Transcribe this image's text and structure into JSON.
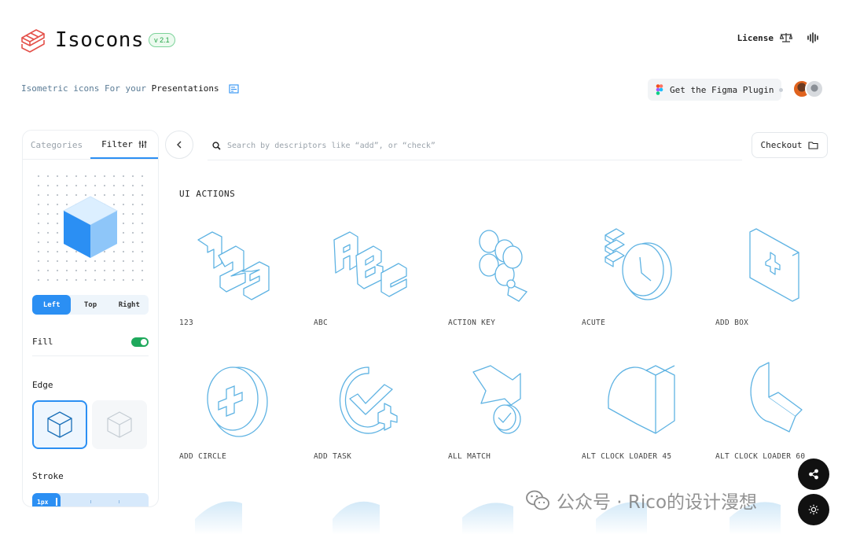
{
  "app": {
    "title": "Isocons",
    "version": "v 2.1",
    "tagline_prefix": "Isometric icons For your",
    "tagline_strong": "Presentations"
  },
  "header": {
    "license_label": "License",
    "figma_label": "Get the Figma Plugin"
  },
  "sidebar": {
    "tabs": [
      {
        "label": "Categories",
        "active": false
      },
      {
        "label": "Filter",
        "active": true
      }
    ],
    "views": [
      {
        "label": "Left",
        "active": true
      },
      {
        "label": "Top",
        "active": false
      },
      {
        "label": "Right",
        "active": false
      }
    ],
    "fill_label": "Fill",
    "fill_on": true,
    "edge_label": "Edge",
    "stroke_label": "Stroke",
    "stroke_value": "1px"
  },
  "search": {
    "placeholder": "Search by descriptors like “add”, or “check”"
  },
  "checkout_label": "Checkout",
  "section": {
    "title": "UI ACTIONS",
    "icons": [
      {
        "label": "123",
        "icon": "numbers-123-icon"
      },
      {
        "label": "ABC",
        "icon": "letters-abc-icon"
      },
      {
        "label": "ACTION KEY",
        "icon": "action-key-icon"
      },
      {
        "label": "ACUTE",
        "icon": "acute-icon"
      },
      {
        "label": "ADD BOX",
        "icon": "add-box-icon"
      },
      {
        "label": "ADD CIRCLE",
        "icon": "add-circle-icon"
      },
      {
        "label": "ADD TASK",
        "icon": "add-task-icon"
      },
      {
        "label": "ALL MATCH",
        "icon": "all-match-icon"
      },
      {
        "label": "ALT CLOCK LOADER 45",
        "icon": "clock-loader-45-icon"
      },
      {
        "label": "ALT CLOCK LOADER 60",
        "icon": "clock-loader-60-icon"
      }
    ]
  },
  "watermark": "公众号 · Rico的设计漫想",
  "colors": {
    "accent": "#2b8ff3",
    "icon_stroke": "#5fb3e3",
    "brand_red": "#e4514a",
    "toggle_on": "#1fa95c"
  }
}
